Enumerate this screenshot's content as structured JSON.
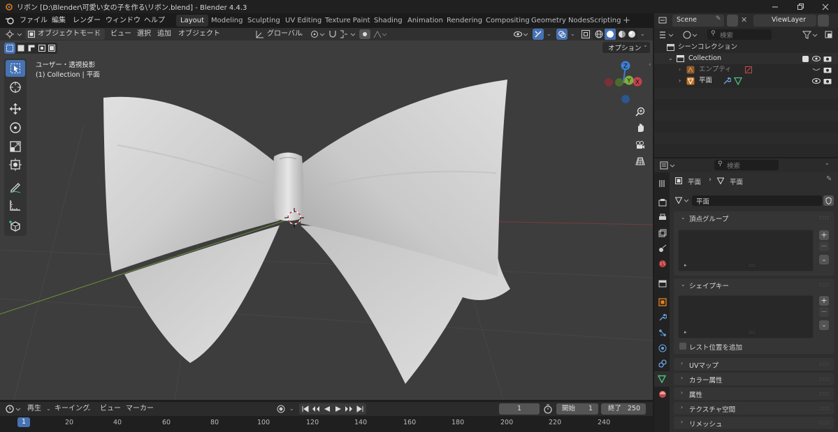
{
  "window": {
    "title": "リボン [D:\\Blender\\可愛い女の子を作る\\リボン.blend] - Blender 4.4.3"
  },
  "menu": {
    "items": [
      "ファイル",
      "編集",
      "レンダー",
      "ウィンドウ",
      "ヘルプ"
    ]
  },
  "workspaces": [
    "Layout",
    "Modeling",
    "Sculpting",
    "UV Editing",
    "Texture Paint",
    "Shading",
    "Animation",
    "Rendering",
    "Compositing",
    "Geometry Nodes",
    "Scripting"
  ],
  "scene": {
    "label": "Scene",
    "viewlayer": "ViewLayer"
  },
  "viewport_header": {
    "mode": "オブジェクトモード",
    "menus": [
      "ビュー",
      "選択",
      "追加",
      "オブジェクト"
    ],
    "transform": "グローバル",
    "options": "オプション"
  },
  "viewport": {
    "view_name": "ユーザー・透視投影",
    "collection_info": "(1) Collection | 平面"
  },
  "gizmo": {
    "z": "Z",
    "y": "Y",
    "x": "X"
  },
  "outliner": {
    "search_placeholder": "検索",
    "scene_collection": "シーンコレクション",
    "collection": "Collection",
    "items": [
      {
        "name": "エンプティ"
      },
      {
        "name": "平面"
      }
    ]
  },
  "properties": {
    "search_placeholder": "検索",
    "breadcrumb_object": "平面",
    "breadcrumb_data": "平面",
    "mesh_name": "平面",
    "panels": {
      "vertex_groups": "頂点グループ",
      "shape_keys": "シェイプキー",
      "rest_position": "レスト位置を追加",
      "uv_maps": "UVマップ",
      "color_attributes": "カラー属性",
      "attributes": "属性",
      "texture_space": "テクスチャ空間",
      "remesh": "リメッシュ"
    }
  },
  "timeline": {
    "menus": [
      "再生",
      "キーイング",
      "ビュー",
      "マーカー"
    ],
    "current_frame": "1",
    "start_label": "開始",
    "start": "1",
    "end_label": "終了",
    "end": "250",
    "ticks": [
      "20",
      "40",
      "60",
      "80",
      "100",
      "120",
      "140",
      "160",
      "180",
      "200",
      "220",
      "240"
    ],
    "playhead": "1"
  },
  "colors": {
    "accent": "#4772b3",
    "axis_x": "#c8404f",
    "axis_y": "#7fb03f",
    "axis_z": "#3d7fd6",
    "mesh_icon": "#4fc07f"
  }
}
